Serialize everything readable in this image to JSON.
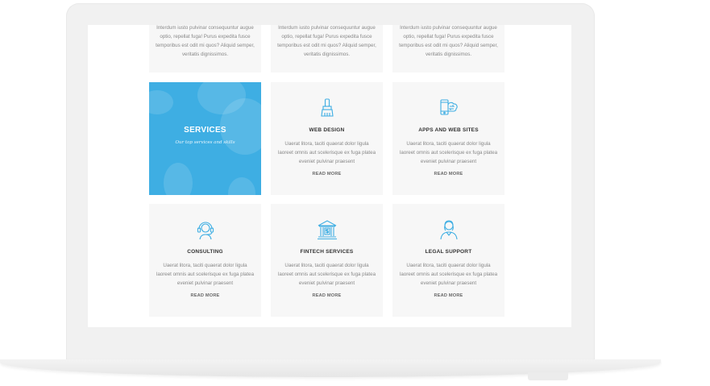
{
  "top_row": [
    {
      "description": "Interdum iusto pulvinar consequuntur augue optio, repellat fuga! Purus expedita fusce temporibus est odit mi quos? Aliquid semper, veritatis dignissimos."
    },
    {
      "description": "Interdum iusto pulvinar consequuntur augue optio, repellat fuga! Purus expedita fusce temporibus est odit mi quos? Aliquid semper, veritatis dignissimos."
    },
    {
      "description": "Interdum iusto pulvinar consequuntur augue optio, repellat fuga! Purus expedita fusce temporibus est odit mi quos? Aliquid semper, veritatis dignissimos."
    }
  ],
  "hero": {
    "title": "SERVICES",
    "subtitle": "Our top services and skills",
    "color": "#3eaee3"
  },
  "services": [
    {
      "title": "WEB DESIGN",
      "icon": "paint-brush-icon",
      "description": "Uaerat litora, taciti quaerat dolor ligula laoreet omnis aut scelerisque ex fuga platea eveniet pulvinar praesent",
      "link": "READ MORE"
    },
    {
      "title": "APPS AND WEB SITES",
      "icon": "mobile-cloud-icon",
      "description": "Uaerat litora, taciti quaerat dolor ligula laoreet omnis aut scelerisque ex fuga platea eveniet pulvinar praesent",
      "link": "READ MORE"
    },
    {
      "title": "CONSULTING",
      "icon": "headset-icon",
      "description": "Uaerat litora, taciti quaerat dolor ligula laoreet omnis aut scelerisque ex fuga platea eveniet pulvinar praesent",
      "link": "READ MORE"
    },
    {
      "title": "FINTECH SERVICES",
      "icon": "bank-icon",
      "description": "Uaerat litora, taciti quaerat dolor ligula laoreet omnis aut scelerisque ex fuga platea eveniet pulvinar praesent",
      "link": "READ MORE"
    },
    {
      "title": "LEGAL SUPPORT",
      "icon": "support-agent-icon",
      "description": "Uaerat litora, taciti quaerat dolor ligula laoreet omnis aut scelerisque ex fuga platea eveniet pulvinar praesent",
      "link": "READ MORE"
    }
  ],
  "accent_color": "#3eaee3"
}
